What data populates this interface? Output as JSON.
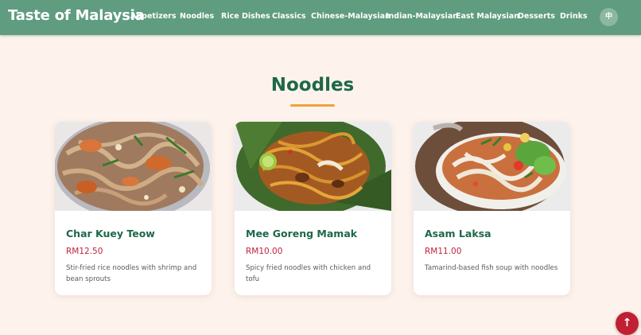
{
  "brand": "Taste of Malaysia",
  "nav": [
    "Appetizers",
    "Noodles",
    "Rice Dishes",
    "Classics",
    "Chinese-Malaysian",
    "Indian-Malaysian",
    "East Malaysian",
    "Desserts",
    "Drinks"
  ],
  "lang_button": "中",
  "section_title": "Noodles",
  "dishes": [
    {
      "name": "Char Kuey Teow",
      "price": "RM12.50",
      "description": "Stir-fried rice noodles with shrimp and bean sprouts"
    },
    {
      "name": "Mee Goreng Mamak",
      "price": "RM10.00",
      "description": "Spicy fried noodles with chicken and tofu"
    },
    {
      "name": "Asam Laksa",
      "price": "RM11.00",
      "description": "Tamarind-based fish soup with noodles"
    }
  ],
  "scroll_top_icon": "↑",
  "colors": {
    "navbar": "#5f9c80",
    "background": "#fdf3ec",
    "heading": "#1d6849",
    "accent_underline": "#f0a23b",
    "price": "#c0233e",
    "scroll_button": "#c12033"
  }
}
